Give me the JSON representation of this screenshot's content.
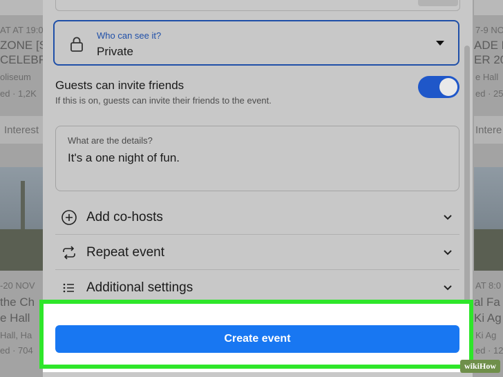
{
  "background": {
    "left_cards": [
      {
        "date": "AT AT 19:00",
        "title_lines": [
          "ZONE [S",
          "CELEBR"
        ],
        "venue": "oliseum",
        "meta": "ed · 1,2K",
        "action": "Interest"
      },
      {
        "date": "-20 NOV",
        "title_lines": [
          "the Ch",
          "e Hall"
        ],
        "venue": "Hall, Ha",
        "meta": "ed · 704",
        "action": ""
      }
    ],
    "right_cards": [
      {
        "date": "7-9 NO",
        "title_lines": [
          "ADE H",
          "ER 20"
        ],
        "venue": "e Hall",
        "meta": "ed · 25",
        "action": "Intere"
      },
      {
        "date": "AT 8:0",
        "title_lines": [
          "al Fa",
          "Ki Ag"
        ],
        "venue": "Ki Ag",
        "meta": "ed · 12",
        "action": ""
      }
    ]
  },
  "modal": {
    "privacy": {
      "label": "Who can see it?",
      "value": "Private"
    },
    "guests_toggle": {
      "title": "Guests can invite friends",
      "description": "If this is on, guests can invite their friends to the event.",
      "on": true
    },
    "details": {
      "label": "What are the details?",
      "value": "It's a one night of fun."
    },
    "rows": [
      {
        "label": "Add co-hosts",
        "icon": "plus-circle-icon"
      },
      {
        "label": "Repeat event",
        "icon": "repeat-icon"
      },
      {
        "label": "Additional settings",
        "icon": "list-icon"
      }
    ],
    "create_button": "Create event"
  },
  "colors": {
    "accent": "#1877f2",
    "focus_border": "#1f4fa8",
    "toggle": "#1f57c9",
    "highlight": "#2ee62a"
  },
  "watermark": {
    "wiki": "wiki",
    "how": "How"
  }
}
